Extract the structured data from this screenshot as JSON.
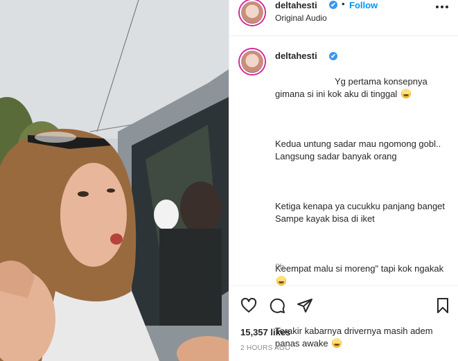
{
  "post": {
    "username": "deltahesti",
    "verified_mark": "✔",
    "separator": "•",
    "follow_label": "Follow",
    "audio_label": "Original Audio",
    "more_icon": "more-horizontal-icon"
  },
  "caption": {
    "username": "deltahesti",
    "line1": "Yg pertama konsepnya gimana si ini kok aku di tinggal",
    "para2": "Kedua untung sadar mau ngomong gobl..\nLangsung sadar banyak orang",
    "para3": "Ketiga kenapa ya cucukku panjang banget\nSampe kayak bisa di iket",
    "para4": "Keempat malu si moreng\" tapi kok ngakak",
    "para5": "Terakir kabarnya drivernya masih adem panas awake",
    "time": "2h"
  },
  "actions": {
    "like_icon": "heart-icon",
    "comment_icon": "comment-icon",
    "share_icon": "send-icon",
    "save_icon": "bookmark-icon",
    "likes_text": "15,357 likes",
    "posted_text": "2 HOURS AGO"
  },
  "colors": {
    "accent": "#0095f6",
    "verified": "#3897f0",
    "muted": "#8e8e8e",
    "text": "#262626"
  }
}
